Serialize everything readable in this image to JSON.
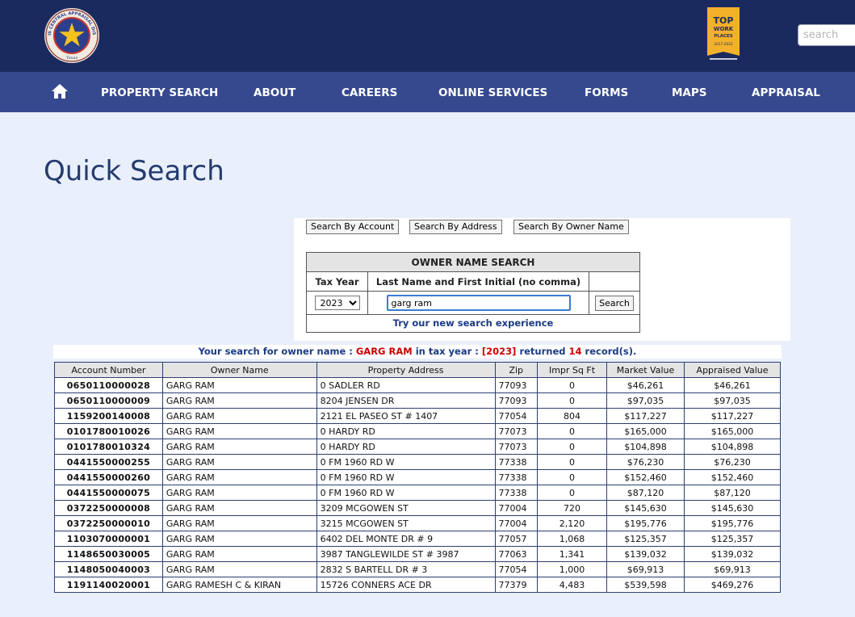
{
  "header": {
    "logo_text_top": "HARRIS CENTRAL APPRAISAL DISTRICT",
    "logo_text_bottom": "Texas",
    "badge": {
      "line1": "TOP",
      "line2": "WORK",
      "line3": "PLACES",
      "years": "2017-2022"
    },
    "search_placeholder": "search"
  },
  "nav": {
    "home_icon": "home-icon",
    "items": [
      "PROPERTY SEARCH",
      "ABOUT",
      "CAREERS",
      "ONLINE SERVICES",
      "FORMS",
      "MAPS",
      "APPRAISAL"
    ]
  },
  "page_title": "Quick Search",
  "search_tabs": [
    "Search By Account",
    "Search By Address",
    "Search By Owner Name"
  ],
  "owner_search": {
    "title": "OWNER NAME SEARCH",
    "col_tax_year": "Tax Year",
    "col_name": "Last Name and First Initial (no comma)",
    "tax_year": "2023",
    "name_value": "garg ram",
    "search_button": "Search",
    "new_experience_link": "Try our new search experience"
  },
  "summary": {
    "prefix": "Your search for owner name :",
    "owner": "GARG RAM",
    "middle": "in tax year :",
    "year": "[2023]",
    "returned": "returned",
    "count": "14",
    "suffix": "record(s)."
  },
  "results": {
    "columns": [
      "Account Number",
      "Owner Name",
      "Property Address",
      "Zip",
      "Impr Sq Ft",
      "Market Value",
      "Appraised Value"
    ],
    "rows": [
      [
        "0650110000028",
        "GARG RAM",
        "0 SADLER RD",
        "77093",
        "0",
        "$46,261",
        "$46,261"
      ],
      [
        "0650110000009",
        "GARG RAM",
        "8204 JENSEN DR",
        "77093",
        "0",
        "$97,035",
        "$97,035"
      ],
      [
        "1159200140008",
        "GARG RAM",
        "2121 EL PASEO ST # 1407",
        "77054",
        "804",
        "$117,227",
        "$117,227"
      ],
      [
        "0101780010026",
        "GARG RAM",
        "0 HARDY RD",
        "77073",
        "0",
        "$165,000",
        "$165,000"
      ],
      [
        "0101780010324",
        "GARG RAM",
        "0 HARDY RD",
        "77073",
        "0",
        "$104,898",
        "$104,898"
      ],
      [
        "0441550000255",
        "GARG RAM",
        "0 FM 1960 RD W",
        "77338",
        "0",
        "$76,230",
        "$76,230"
      ],
      [
        "0441550000260",
        "GARG RAM",
        "0 FM 1960 RD W",
        "77338",
        "0",
        "$152,460",
        "$152,460"
      ],
      [
        "0441550000075",
        "GARG RAM",
        "0 FM 1960 RD W",
        "77338",
        "0",
        "$87,120",
        "$87,120"
      ],
      [
        "0372250000008",
        "GARG RAM",
        "3209 MCGOWEN ST",
        "77004",
        "720",
        "$145,630",
        "$145,630"
      ],
      [
        "0372250000010",
        "GARG RAM",
        "3215 MCGOWEN ST",
        "77004",
        "2,120",
        "$195,776",
        "$195,776"
      ],
      [
        "1103070000001",
        "GARG RAM",
        "6402 DEL MONTE DR # 9",
        "77057",
        "1,068",
        "$125,357",
        "$125,357"
      ],
      [
        "1148650030005",
        "GARG RAM",
        "3987 TANGLEWILDE ST # 3987",
        "77063",
        "1,341",
        "$139,032",
        "$139,032"
      ],
      [
        "1148050040003",
        "GARG RAM",
        "2832 S BARTELL DR # 3",
        "77054",
        "1,000",
        "$69,913",
        "$69,913"
      ],
      [
        "1191140020001",
        "GARG RAMESH C & KIRAN",
        "15726 CONNERS ACE DR",
        "77379",
        "4,483",
        "$539,598",
        "$469,276"
      ]
    ]
  }
}
